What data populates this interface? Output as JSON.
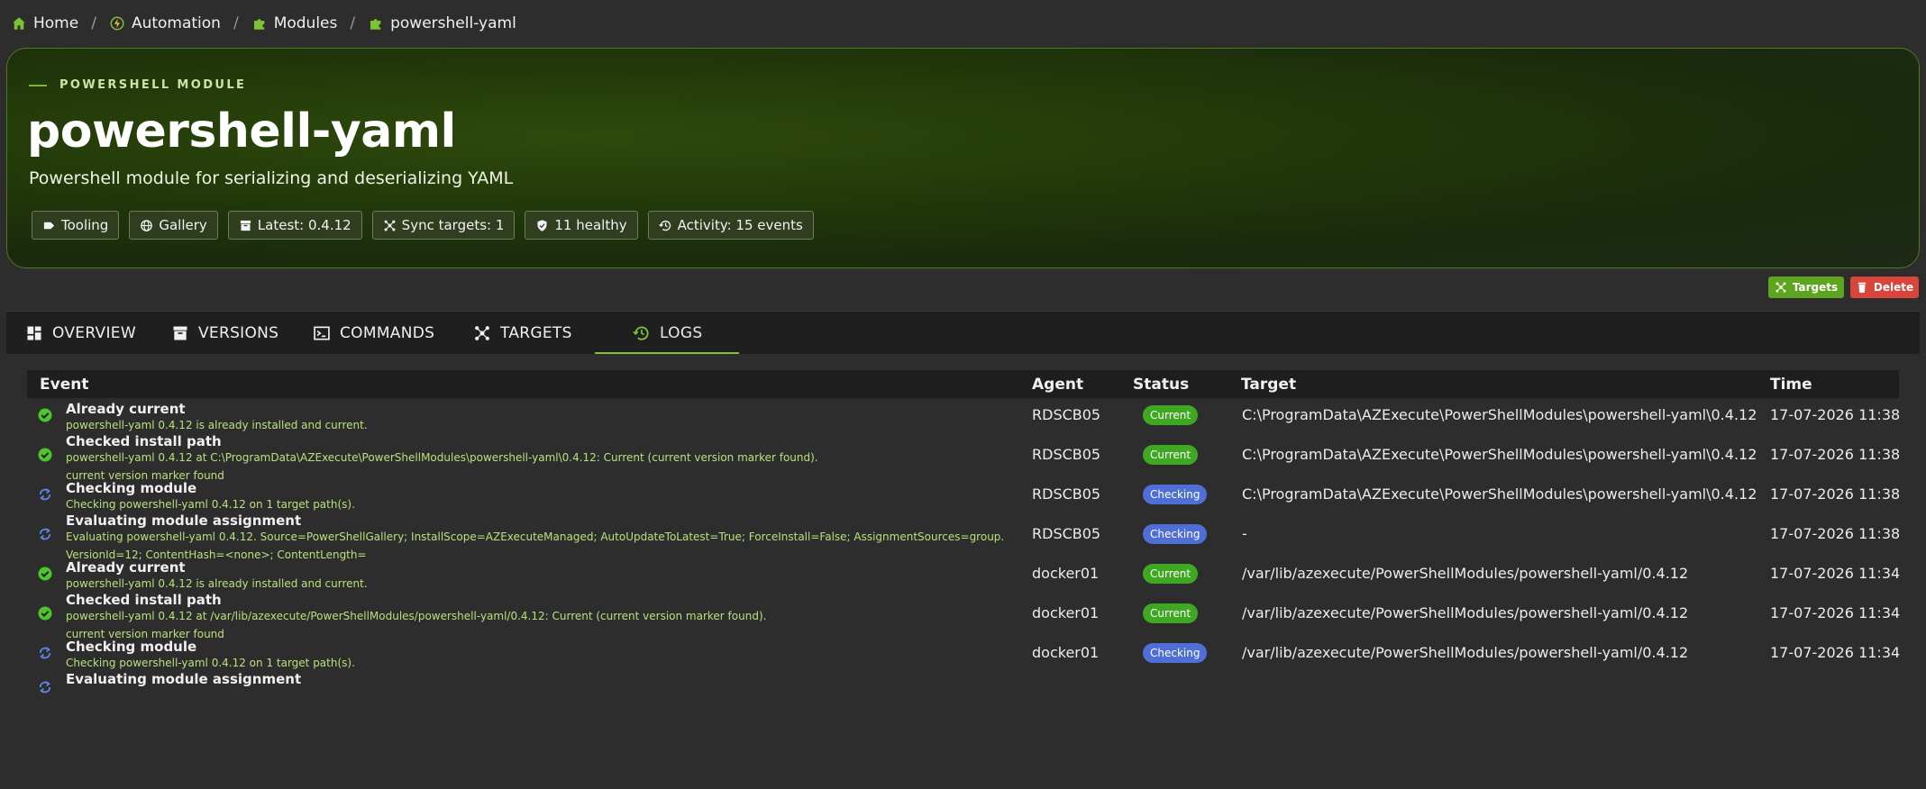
{
  "breadcrumb": [
    {
      "label": "Home",
      "icon": "home-icon"
    },
    {
      "label": "Automation",
      "icon": "automation-icon"
    },
    {
      "label": "Modules",
      "icon": "puzzle-icon"
    },
    {
      "label": "powershell-yaml",
      "icon": "puzzle-icon"
    }
  ],
  "hero": {
    "eyebrow": "POWERSHELL MODULE",
    "title": "powershell-yaml",
    "description": "Powershell module for serializing and deserializing YAML",
    "chips": [
      {
        "label": "Tooling",
        "icon": "tag-icon"
      },
      {
        "label": "Gallery",
        "icon": "globe-icon"
      },
      {
        "label": "Latest: 0.4.12",
        "icon": "archive-icon"
      },
      {
        "label": "Sync targets: 1",
        "icon": "network-icon"
      },
      {
        "label": "11 healthy",
        "icon": "shield-icon"
      },
      {
        "label": "Activity: 15 events",
        "icon": "history-icon"
      }
    ]
  },
  "actions": {
    "targets_label": "Targets",
    "delete_label": "Delete"
  },
  "tabs": [
    {
      "label": "OVERVIEW",
      "icon": "dashboard-icon"
    },
    {
      "label": "VERSIONS",
      "icon": "archive-icon"
    },
    {
      "label": "COMMANDS",
      "icon": "terminal-icon"
    },
    {
      "label": "TARGETS",
      "icon": "network-icon"
    },
    {
      "label": "LOGS",
      "icon": "history-icon",
      "active": true
    }
  ],
  "table": {
    "headers": [
      "Event",
      "Agent",
      "Status",
      "Target",
      "Time"
    ],
    "rows": [
      {
        "icon": "check-circle-icon",
        "title": "Already current",
        "detail": [
          "powershell-yaml 0.4.12 is already installed and current."
        ],
        "agent": "RDSCB05",
        "status": "Current",
        "target": "C:\\ProgramData\\AZExecute\\PowerShellModules\\powershell-yaml\\0.4.12",
        "time": "17-07-2026 11:38"
      },
      {
        "icon": "check-circle-icon",
        "title": "Checked install path",
        "detail": [
          "powershell-yaml 0.4.12 at C:\\ProgramData\\AZExecute\\PowerShellModules\\powershell-yaml\\0.4.12: Current (current version marker found).",
          "current version marker found"
        ],
        "agent": "RDSCB05",
        "status": "Current",
        "target": "C:\\ProgramData\\AZExecute\\PowerShellModules\\powershell-yaml\\0.4.12",
        "time": "17-07-2026 11:38"
      },
      {
        "icon": "sync-icon",
        "title": "Checking module",
        "detail": [
          "Checking powershell-yaml 0.4.12 on 1 target path(s)."
        ],
        "agent": "RDSCB05",
        "status": "Checking",
        "target": "C:\\ProgramData\\AZExecute\\PowerShellModules\\powershell-yaml\\0.4.12",
        "time": "17-07-2026 11:38"
      },
      {
        "icon": "sync-icon",
        "title": "Evaluating module assignment",
        "detail": [
          "Evaluating powershell-yaml 0.4.12. Source=PowerShellGallery; InstallScope=AZExecuteManaged; AutoUpdateToLatest=True; ForceInstall=False; AssignmentSources=group.",
          "VersionId=12; ContentHash=<none>; ContentLength="
        ],
        "agent": "RDSCB05",
        "status": "Checking",
        "target": "-",
        "time": "17-07-2026 11:38"
      },
      {
        "icon": "check-circle-icon",
        "title": "Already current",
        "detail": [
          "powershell-yaml 0.4.12 is already installed and current."
        ],
        "agent": "docker01",
        "status": "Current",
        "target": "/var/lib/azexecute/PowerShellModules/powershell-yaml/0.4.12",
        "time": "17-07-2026 11:34"
      },
      {
        "icon": "check-circle-icon",
        "title": "Checked install path",
        "detail": [
          "powershell-yaml 0.4.12 at /var/lib/azexecute/PowerShellModules/powershell-yaml/0.4.12: Current (current version marker found).",
          "current version marker found"
        ],
        "agent": "docker01",
        "status": "Current",
        "target": "/var/lib/azexecute/PowerShellModules/powershell-yaml/0.4.12",
        "time": "17-07-2026 11:34"
      },
      {
        "icon": "sync-icon",
        "title": "Checking module",
        "detail": [
          "Checking powershell-yaml 0.4.12 on 1 target path(s)."
        ],
        "agent": "docker01",
        "status": "Checking",
        "target": "/var/lib/azexecute/PowerShellModules/powershell-yaml/0.4.12",
        "time": "17-07-2026 11:34"
      },
      {
        "icon": "sync-icon",
        "title": "Evaluating module assignment",
        "detail": [],
        "agent": "",
        "status": "",
        "target": "",
        "time": ""
      }
    ]
  },
  "colors": {
    "accent": "#7cc234",
    "current": "#3fa822",
    "checking": "#4f6fd6",
    "danger": "#d9453a",
    "detail_text": "#b9e07c"
  }
}
